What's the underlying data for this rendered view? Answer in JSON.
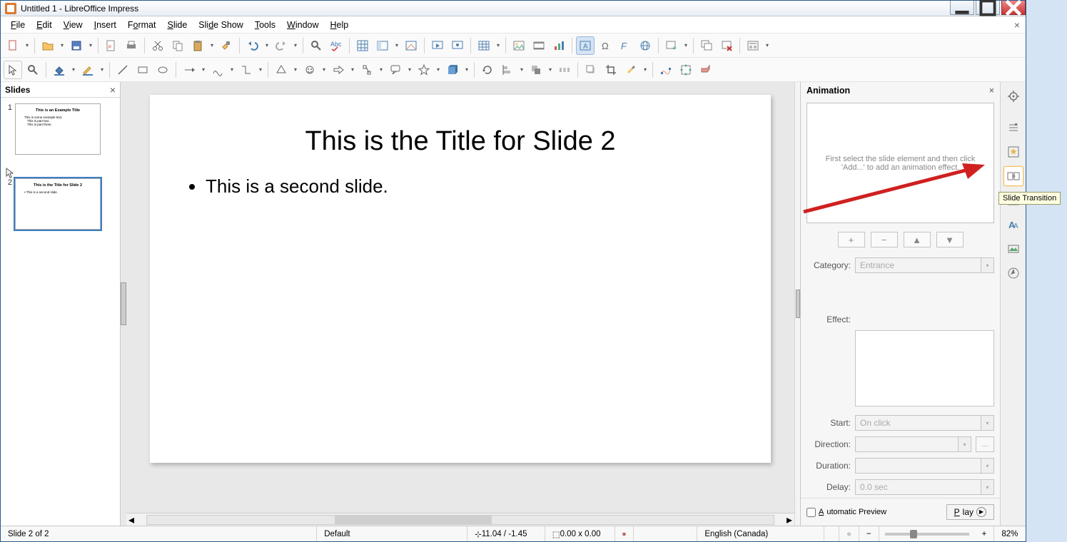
{
  "window": {
    "title": "Untitled 1 - LibreOffice Impress"
  },
  "menu": [
    "File",
    "Edit",
    "View",
    "Insert",
    "Format",
    "Slide",
    "Slide Show",
    "Tools",
    "Window",
    "Help"
  ],
  "slides_panel": {
    "title": "Slides"
  },
  "slides": [
    {
      "num": "1",
      "title": "This is an Example Title",
      "lines": [
        "This is some example text.",
        "This is part two.",
        "This is part three."
      ]
    },
    {
      "num": "2",
      "title": "This is the Title for Slide 2",
      "lines": [
        "This is a second slide."
      ]
    }
  ],
  "current_slide": {
    "title": "This is the Title for Slide 2",
    "bullets": [
      "This is a second slide."
    ]
  },
  "animation_panel": {
    "title": "Animation",
    "hint": "First select the slide element and then click 'Add...' to add an animation effect.",
    "category_label": "Category:",
    "category_value": "Entrance",
    "effect_label": "Effect:",
    "start_label": "Start:",
    "start_value": "On click",
    "direction_label": "Direction:",
    "duration_label": "Duration:",
    "delay_label": "Delay:",
    "delay_value": "0.0 sec",
    "auto_preview": "Automatic Preview",
    "play": "Play"
  },
  "tooltip": "Slide Transition",
  "status": {
    "slide": "Slide 2 of 2",
    "master": "Default",
    "pos": "11.04 / -1.45",
    "size": "0.00 x 0.00",
    "lang": "English (Canada)",
    "zoom": "82%"
  }
}
